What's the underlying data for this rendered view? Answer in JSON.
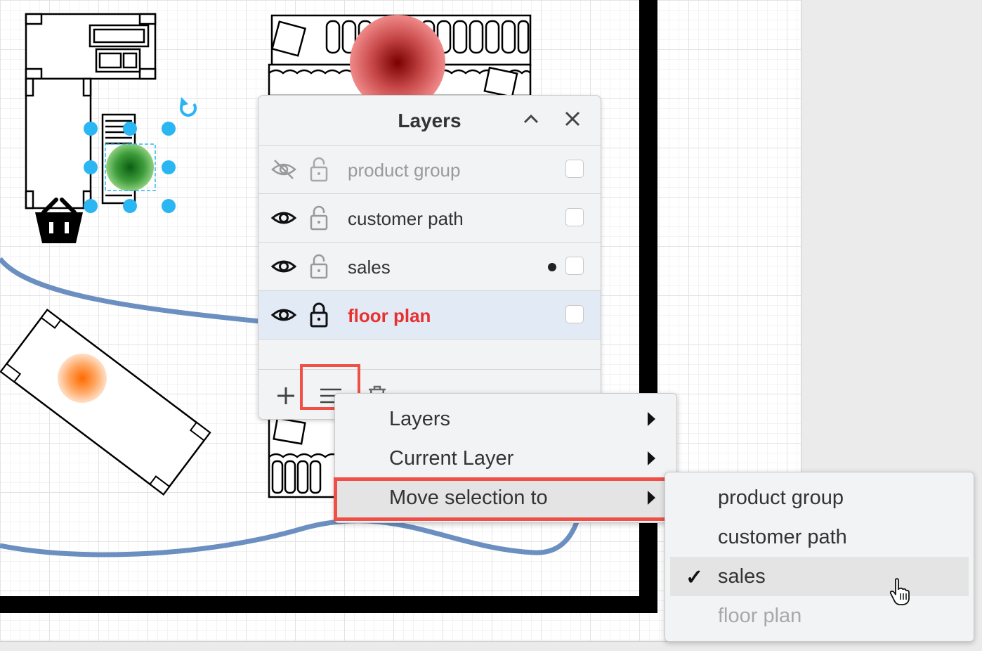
{
  "layers_panel": {
    "title": "Layers",
    "layers": [
      {
        "name": "product group",
        "visible": false,
        "locked": false,
        "current": false,
        "selected": false
      },
      {
        "name": "customer path",
        "visible": true,
        "locked": false,
        "current": false,
        "selected": false
      },
      {
        "name": "sales",
        "visible": true,
        "locked": false,
        "current": true,
        "selected": false
      },
      {
        "name": "floor plan",
        "visible": true,
        "locked": true,
        "current": false,
        "selected": true
      }
    ]
  },
  "context_menu": {
    "items": [
      {
        "label": "Layers",
        "has_submenu": true
      },
      {
        "label": "Current Layer",
        "has_submenu": true
      },
      {
        "label": "Move selection to",
        "has_submenu": true
      }
    ]
  },
  "submenu": {
    "items": [
      {
        "label": "product group",
        "checked": false,
        "disabled": false
      },
      {
        "label": "customer path",
        "checked": false,
        "disabled": false
      },
      {
        "label": "sales",
        "checked": true,
        "disabled": false
      },
      {
        "label": "floor plan",
        "checked": false,
        "disabled": true
      }
    ]
  },
  "colors": {
    "accent_red": "#ef4f46",
    "selected_layer_text": "#e8302e",
    "selected_row_bg": "#e2eaf6",
    "path_blue": "#6b8fc0",
    "handle_blue": "#29b6f2"
  }
}
